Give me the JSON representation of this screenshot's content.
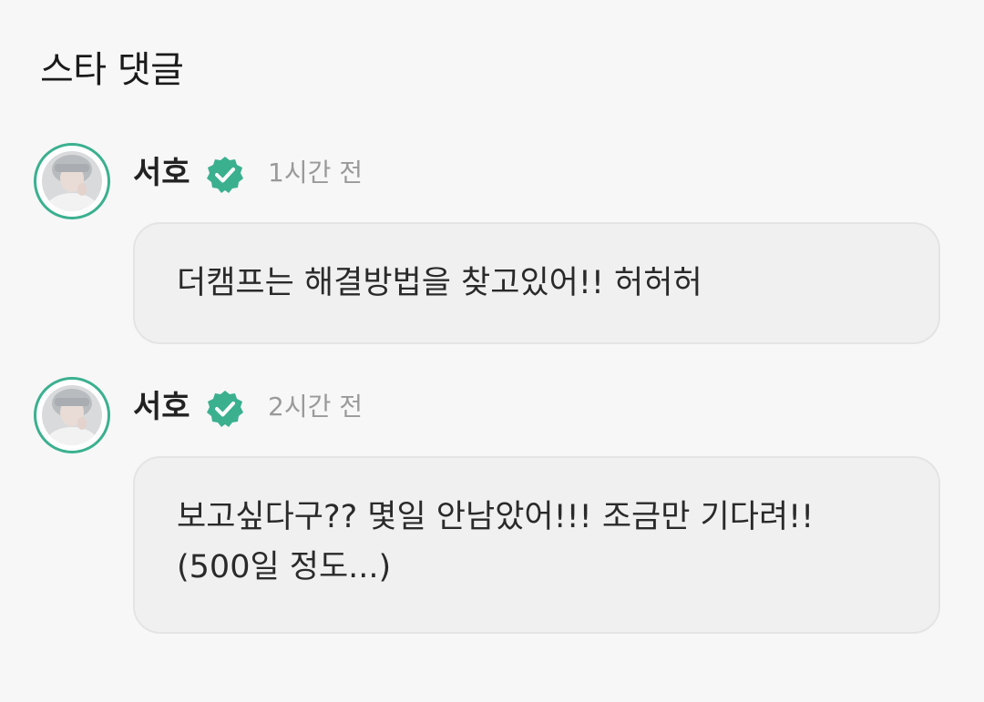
{
  "section": {
    "title": "스타 댓글"
  },
  "colors": {
    "accent": "#3bb08f",
    "bubble_bg": "#f0f0f0",
    "page_bg": "#f7f7f7",
    "time_text": "#9a9a9a"
  },
  "comments": [
    {
      "author": "서호",
      "verified_icon": "verified-badge-icon",
      "time": "1시간 전",
      "text": "더캠프는 해결방법을 찾고있어!! 허허허"
    },
    {
      "author": "서호",
      "verified_icon": "verified-badge-icon",
      "time": "2시간 전",
      "text": "보고싶다구?? 몇일 안남았어!!! 조금만 기다려!!\n(500일 정도...)"
    }
  ]
}
